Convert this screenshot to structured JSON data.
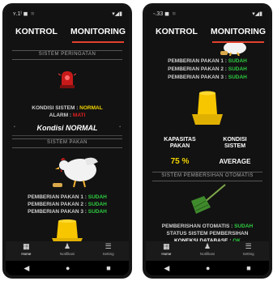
{
  "left": {
    "status_time": "ʏ.1ᴵ ◼ ◾",
    "status_icons": "▾◢▮",
    "tabs": [
      "KONTROL",
      "MONITORING"
    ],
    "section_warning": "SISTEM PERINGATAN",
    "kondisi_label": "KONDISI SISTEM :",
    "kondisi_value": "NORMAL",
    "alarm_label": "ALARM :",
    "alarm_value": "MATI",
    "banner": "Kondisi NORMAL",
    "section_feed": "SISTEM PAKAN",
    "feed_rows": [
      {
        "label": "PEMBERIAN PAKAN 1 :",
        "value": "SUDAH"
      },
      {
        "label": "PEMBERIAN PAKAN 2 :",
        "value": "SUDAH"
      },
      {
        "label": "PEMBERIAN PAKAN 3 :",
        "value": "SUDAH"
      }
    ]
  },
  "right": {
    "status_time": "◦.33 ◼ ◾",
    "status_icons": "▾◢▮",
    "tabs": [
      "KONTROL",
      "MONITORING"
    ],
    "feed_rows": [
      {
        "label": "PEMBERIAN PAKAN 1 :",
        "value": "SUDAH"
      },
      {
        "label": "PEMBERIAN PAKAN 2 :",
        "value": "SUDAH"
      },
      {
        "label": "PEMBERIAN PAKAN 3 :",
        "value": "SUDAH"
      }
    ],
    "kapasitas_label": "KAPASITAS\nPAKAN",
    "kapasitas_value": "75 %",
    "kondisi_label": "KONDISI\nSISTEM",
    "kondisi_value": "AVERAGE",
    "section_clean": "SISTEM PEMBERSIHAN OTOMATIS",
    "clean_label": "PEMBERISHAN OTOMATIS :",
    "clean_value": "SUDAH",
    "status_clean": "STATUS SISTEM PEMBERSIHAN",
    "db_label": "KONEKSI DATABASE :",
    "db_value": "OK"
  },
  "navbar": [
    {
      "label": "Home",
      "icon": "home-icon",
      "glyph": "▦"
    },
    {
      "label": "Notifikasi",
      "icon": "bell-icon",
      "glyph": "♟"
    },
    {
      "label": "Setting",
      "icon": "menu-icon",
      "glyph": "☰"
    }
  ],
  "sysnav": {
    "back": "◀",
    "home": "●",
    "recent": "■"
  },
  "colors": {
    "accent": "#e5402d",
    "ok": "#2ecc40",
    "warn": "#f3d400",
    "bad": "#e02020",
    "feeder": "#f7c600"
  }
}
